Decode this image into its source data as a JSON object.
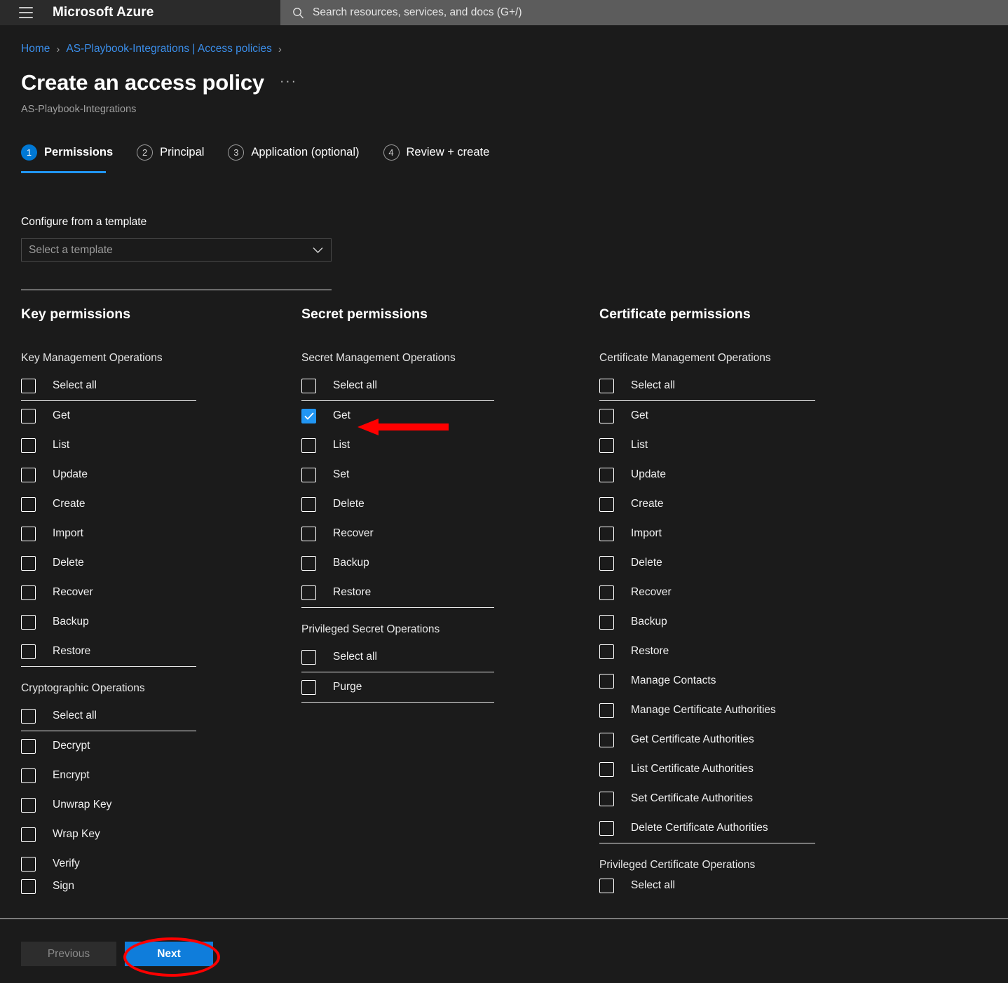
{
  "topbar": {
    "brand": "Microsoft Azure",
    "menu_icon": "hamburger-icon",
    "search_placeholder": "Search resources, services, and docs (G+/)",
    "search_icon": "search-icon"
  },
  "breadcrumb": {
    "items": [
      "Home",
      "AS-Playbook-Integrations | Access policies"
    ],
    "separator": "›"
  },
  "header": {
    "title": "Create an access policy",
    "ellipsis": "···",
    "subtitle": "AS-Playbook-Integrations"
  },
  "steps": [
    {
      "number": "1",
      "label": "Permissions",
      "active": true
    },
    {
      "number": "2",
      "label": "Principal",
      "active": false
    },
    {
      "number": "3",
      "label": "Application (optional)",
      "active": false
    },
    {
      "number": "4",
      "label": "Review + create",
      "active": false
    }
  ],
  "template": {
    "label": "Configure from a template",
    "placeholder": "Select a template",
    "chevron_icon": "chevron-down-icon"
  },
  "columns": [
    {
      "title": "Key permissions",
      "groups": [
        {
          "title": "Key Management Operations",
          "select_all": {
            "label": "Select all",
            "checked": false
          },
          "items": [
            {
              "label": "Get",
              "checked": false
            },
            {
              "label": "List",
              "checked": false
            },
            {
              "label": "Update",
              "checked": false
            },
            {
              "label": "Create",
              "checked": false
            },
            {
              "label": "Import",
              "checked": false
            },
            {
              "label": "Delete",
              "checked": false
            },
            {
              "label": "Recover",
              "checked": false
            },
            {
              "label": "Backup",
              "checked": false
            },
            {
              "label": "Restore",
              "checked": false
            }
          ]
        },
        {
          "title": "Cryptographic Operations",
          "select_all": {
            "label": "Select all",
            "checked": false
          },
          "items": [
            {
              "label": "Decrypt",
              "checked": false
            },
            {
              "label": "Encrypt",
              "checked": false
            },
            {
              "label": "Unwrap Key",
              "checked": false
            },
            {
              "label": "Wrap Key",
              "checked": false
            },
            {
              "label": "Verify",
              "checked": false
            },
            {
              "label": "Sign",
              "checked": false,
              "clipped": true
            }
          ]
        }
      ]
    },
    {
      "title": "Secret permissions",
      "groups": [
        {
          "title": "Secret Management Operations",
          "select_all": {
            "label": "Select all",
            "checked": false
          },
          "items": [
            {
              "label": "Get",
              "checked": true
            },
            {
              "label": "List",
              "checked": false
            },
            {
              "label": "Set",
              "checked": false
            },
            {
              "label": "Delete",
              "checked": false
            },
            {
              "label": "Recover",
              "checked": false
            },
            {
              "label": "Backup",
              "checked": false
            },
            {
              "label": "Restore",
              "checked": false
            }
          ]
        },
        {
          "title": "Privileged Secret Operations",
          "select_all": {
            "label": "Select all",
            "checked": false
          },
          "items": [
            {
              "label": "Purge",
              "checked": false
            }
          ]
        }
      ]
    },
    {
      "title": "Certificate permissions",
      "groups": [
        {
          "title": "Certificate Management Operations",
          "select_all": {
            "label": "Select all",
            "checked": false
          },
          "items": [
            {
              "label": "Get",
              "checked": false
            },
            {
              "label": "List",
              "checked": false
            },
            {
              "label": "Update",
              "checked": false
            },
            {
              "label": "Create",
              "checked": false
            },
            {
              "label": "Import",
              "checked": false
            },
            {
              "label": "Delete",
              "checked": false
            },
            {
              "label": "Recover",
              "checked": false
            },
            {
              "label": "Backup",
              "checked": false
            },
            {
              "label": "Restore",
              "checked": false
            },
            {
              "label": "Manage Contacts",
              "checked": false
            },
            {
              "label": "Manage Certificate Authorities",
              "checked": false
            },
            {
              "label": "Get Certificate Authorities",
              "checked": false
            },
            {
              "label": "List Certificate Authorities",
              "checked": false
            },
            {
              "label": "Set Certificate Authorities",
              "checked": false
            },
            {
              "label": "Delete Certificate Authorities",
              "checked": false
            }
          ]
        },
        {
          "title": "Privileged Certificate Operations",
          "select_all": {
            "label": "Select all",
            "checked": false,
            "clipped": true
          },
          "items": []
        }
      ]
    }
  ],
  "footer": {
    "previous_label": "Previous",
    "next_label": "Next"
  },
  "annotations": {
    "arrow_color": "#ff0000",
    "ellipse_color": "#ff0000",
    "arrow_target": "Get",
    "ellipse_target": "Next"
  },
  "colors": {
    "accent": "#0078d4",
    "checkbox_checked": "#2196f3",
    "background": "#1b1b1b",
    "topbar": "#2b2b2b",
    "link": "#3b8eea"
  }
}
